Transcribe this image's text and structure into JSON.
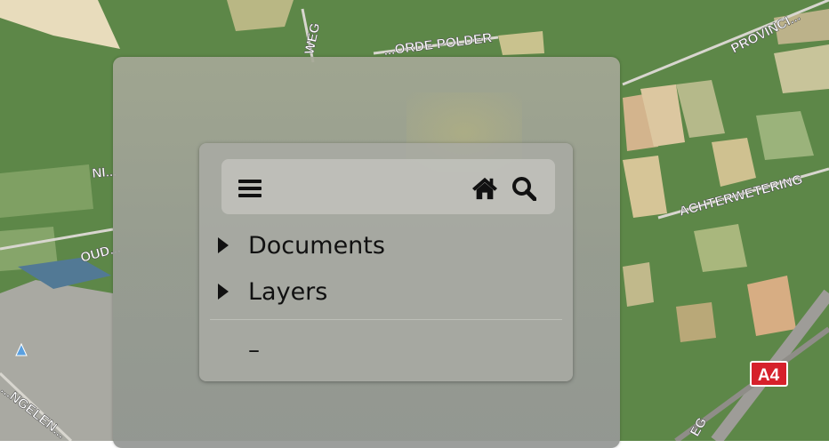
{
  "map": {
    "road_labels": [
      "WEG",
      "...ORDE POLDER",
      "PROVINCI...",
      "NI...",
      "ACHTERWETERING",
      "OUD...",
      "...NGELEN...",
      "EG"
    ],
    "road_shield": "A4",
    "colors": {
      "fields": "#5f8a4a",
      "road_shield_bg": "#d6212b"
    }
  },
  "menu": {
    "toolbar": {
      "menu_icon": "hamburger-menu-icon",
      "home_icon": "home-icon",
      "search_icon": "search-icon"
    },
    "items": [
      {
        "label": "Documents",
        "icon": "caret-right-icon"
      },
      {
        "label": "Layers",
        "icon": "caret-right-icon"
      }
    ],
    "placeholder_text": "–"
  }
}
